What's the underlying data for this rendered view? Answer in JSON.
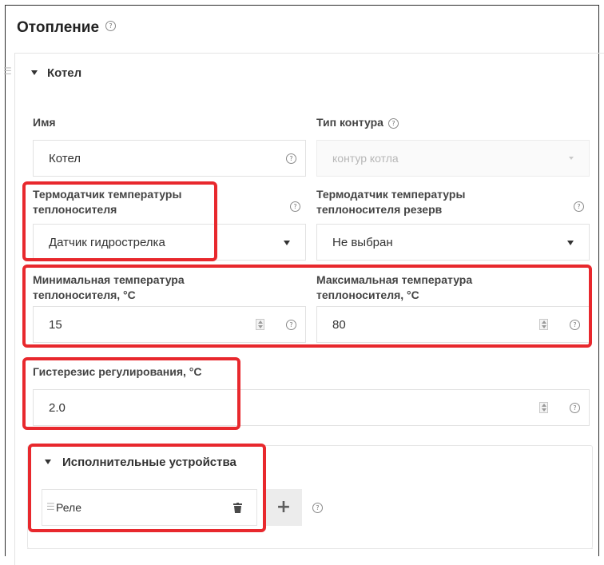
{
  "section": {
    "title": "Отопление"
  },
  "boiler": {
    "header": "Котел",
    "name": {
      "label": "Имя",
      "value": "Котел"
    },
    "circuit_type": {
      "label": "Тип контура",
      "value": "контур котла"
    },
    "sensor": {
      "label_line1": "Термодатчик температуры",
      "label_line2": "теплоносителя",
      "value": "Датчик гидрострелка"
    },
    "sensor_reserve": {
      "label_line1": "Термодатчик температуры",
      "label_line2": "теплоносителя резерв",
      "value": "Не выбран"
    },
    "min_temp": {
      "label_line1": "Минимальная температура",
      "label_line2": "теплоносителя, °C",
      "value": "15"
    },
    "max_temp": {
      "label_line1": "Максимальная температура",
      "label_line2": "теплоносителя, °C",
      "value": "80"
    },
    "hysteresis": {
      "label": "Гистерезис регулирования, °C",
      "value": "2.0"
    }
  },
  "actuators": {
    "header": "Исполнительные устройства",
    "items": [
      {
        "name": "Реле"
      }
    ],
    "add_label": "+"
  },
  "icons": {
    "help": "?"
  },
  "colors": {
    "highlight": "#e8282d",
    "border": "#e2e2e2",
    "text": "#333333"
  }
}
